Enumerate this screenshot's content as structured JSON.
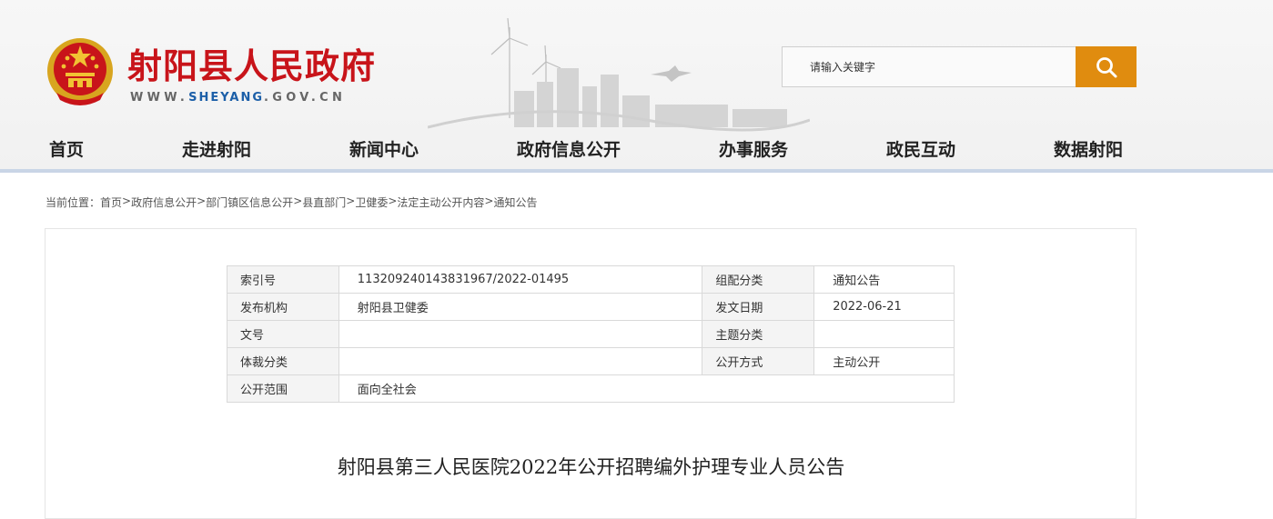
{
  "header": {
    "site_title": "射阳县人民政府",
    "url_prefix": "WWW.",
    "url_highlight": "SHEYANG",
    "url_suffix": ".GOV.CN",
    "brand_color": "#c8141a"
  },
  "search": {
    "placeholder": "请输入关键字",
    "button_color": "#e08c0f",
    "icon": "search-icon"
  },
  "nav": {
    "items": [
      "首页",
      "走进射阳",
      "新闻中心",
      "政府信息公开",
      "办事服务",
      "政民互动",
      "数据射阳"
    ]
  },
  "breadcrumb": {
    "label": "当前位置：",
    "items": [
      "首页",
      "政府信息公开",
      "部门镇区信息公开",
      "县直部门",
      "卫健委",
      "法定主动公开内容",
      "通知公告"
    ],
    "separator": ">"
  },
  "meta_table": {
    "rows": [
      {
        "k1": "索引号",
        "v1": "113209240143831967/2022-01495",
        "k2": "组配分类",
        "v2": "通知公告"
      },
      {
        "k1": "发布机构",
        "v1": "射阳县卫健委",
        "k2": "发文日期",
        "v2": "2022-06-21"
      },
      {
        "k1": "文号",
        "v1": "",
        "k2": "主题分类",
        "v2": ""
      },
      {
        "k1": "体裁分类",
        "v1": "",
        "k2": "公开方式",
        "v2": "主动公开"
      },
      {
        "k1": "公开范围",
        "v1": "面向全社会"
      }
    ]
  },
  "article": {
    "title": "射阳县第三人民医院2022年公开招聘编外护理专业人员公告"
  }
}
